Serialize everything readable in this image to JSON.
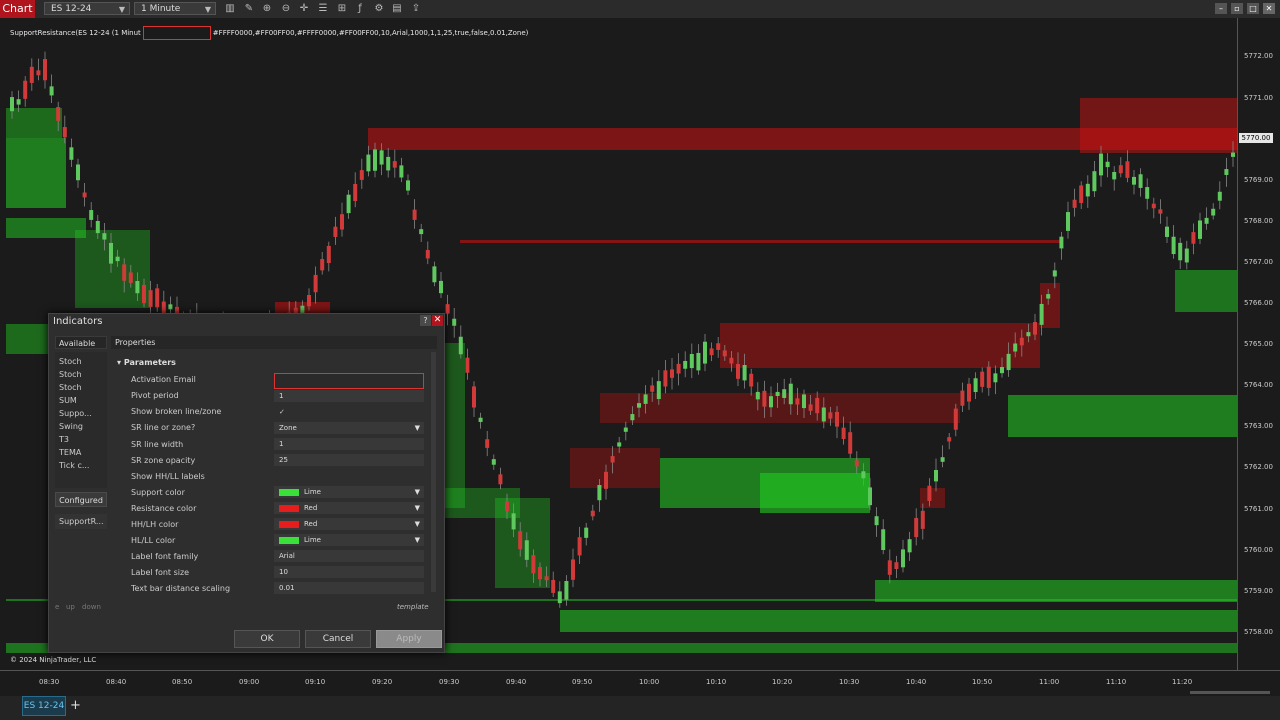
{
  "app": {
    "window_tab": "Chart",
    "instrument": "ES 12-24",
    "interval": "1 Minute"
  },
  "indicator_label": {
    "prefix": "SupportResistance(ES 12-24 (1 Minut",
    "suffix": "#FFFF0000,#FF00FF00,#FFFF0000,#FF00FF00,10,Arial,1000,1,1,25,true,false,0.01,Zone)"
  },
  "price_scale": {
    "labels": [
      "5772.00",
      "5771.00",
      "5769.00",
      "5768.00",
      "5767.00",
      "5766.00",
      "5765.00",
      "5764.00",
      "5763.00",
      "5762.00",
      "5761.00",
      "5760.00",
      "5759.00",
      "5758.00"
    ],
    "current_price": "5770.00"
  },
  "time_scale": {
    "labels": [
      "08:30",
      "08:40",
      "08:50",
      "09:00",
      "09:10",
      "09:20",
      "09:30",
      "09:40",
      "09:50",
      "10:00",
      "10:10",
      "10:20",
      "10:30",
      "10:40",
      "10:50",
      "11:00",
      "11:10",
      "11:20"
    ]
  },
  "copyright": "© 2024 NinjaTrader, LLC",
  "bottom_tab": "ES 12-24",
  "dialog": {
    "title": "Indicators",
    "help": "?",
    "close": "✕",
    "available_header": "Available",
    "available_items": [
      "Stoch",
      "Stoch",
      "Stoch",
      "SUM",
      "Suppo...",
      "Swing",
      "T3",
      "TEMA",
      "Tick c..."
    ],
    "configured_button": "Configured",
    "configured_item": "SupportR...",
    "properties_header": "Properties",
    "section": "Parameters",
    "params": [
      {
        "label": "Activation Email",
        "value": ""
      },
      {
        "label": "Pivot period",
        "value": "1"
      },
      {
        "label": "Show broken line/zone",
        "value": "✓"
      },
      {
        "label": "SR line or zone?",
        "value": "Zone"
      },
      {
        "label": "SR line width",
        "value": "1"
      },
      {
        "label": "SR zone opacity",
        "value": "25"
      },
      {
        "label": "Show HH/LL labels",
        "value": ""
      },
      {
        "label": "Support color",
        "value": "Lime"
      },
      {
        "label": "Resistance color",
        "value": "Red"
      },
      {
        "label": "HH/LH color",
        "value": "Red"
      },
      {
        "label": "HL/LL color",
        "value": "Lime"
      },
      {
        "label": "Label font family",
        "value": "Arial"
      },
      {
        "label": "Label font size",
        "value": "10"
      },
      {
        "label": "Text bar distance scaling",
        "value": "0.01"
      }
    ],
    "nav_small": [
      "e",
      "up",
      "down"
    ],
    "template_link": "template",
    "ok": "OK",
    "cancel": "Cancel",
    "apply": "Apply"
  },
  "colors": {
    "support": "#22cc22",
    "resistance": "#cc1111",
    "bullish_candle": "#5fc95f",
    "bearish_candle": "#d23a3a",
    "accent_tab": "#b0141c"
  }
}
